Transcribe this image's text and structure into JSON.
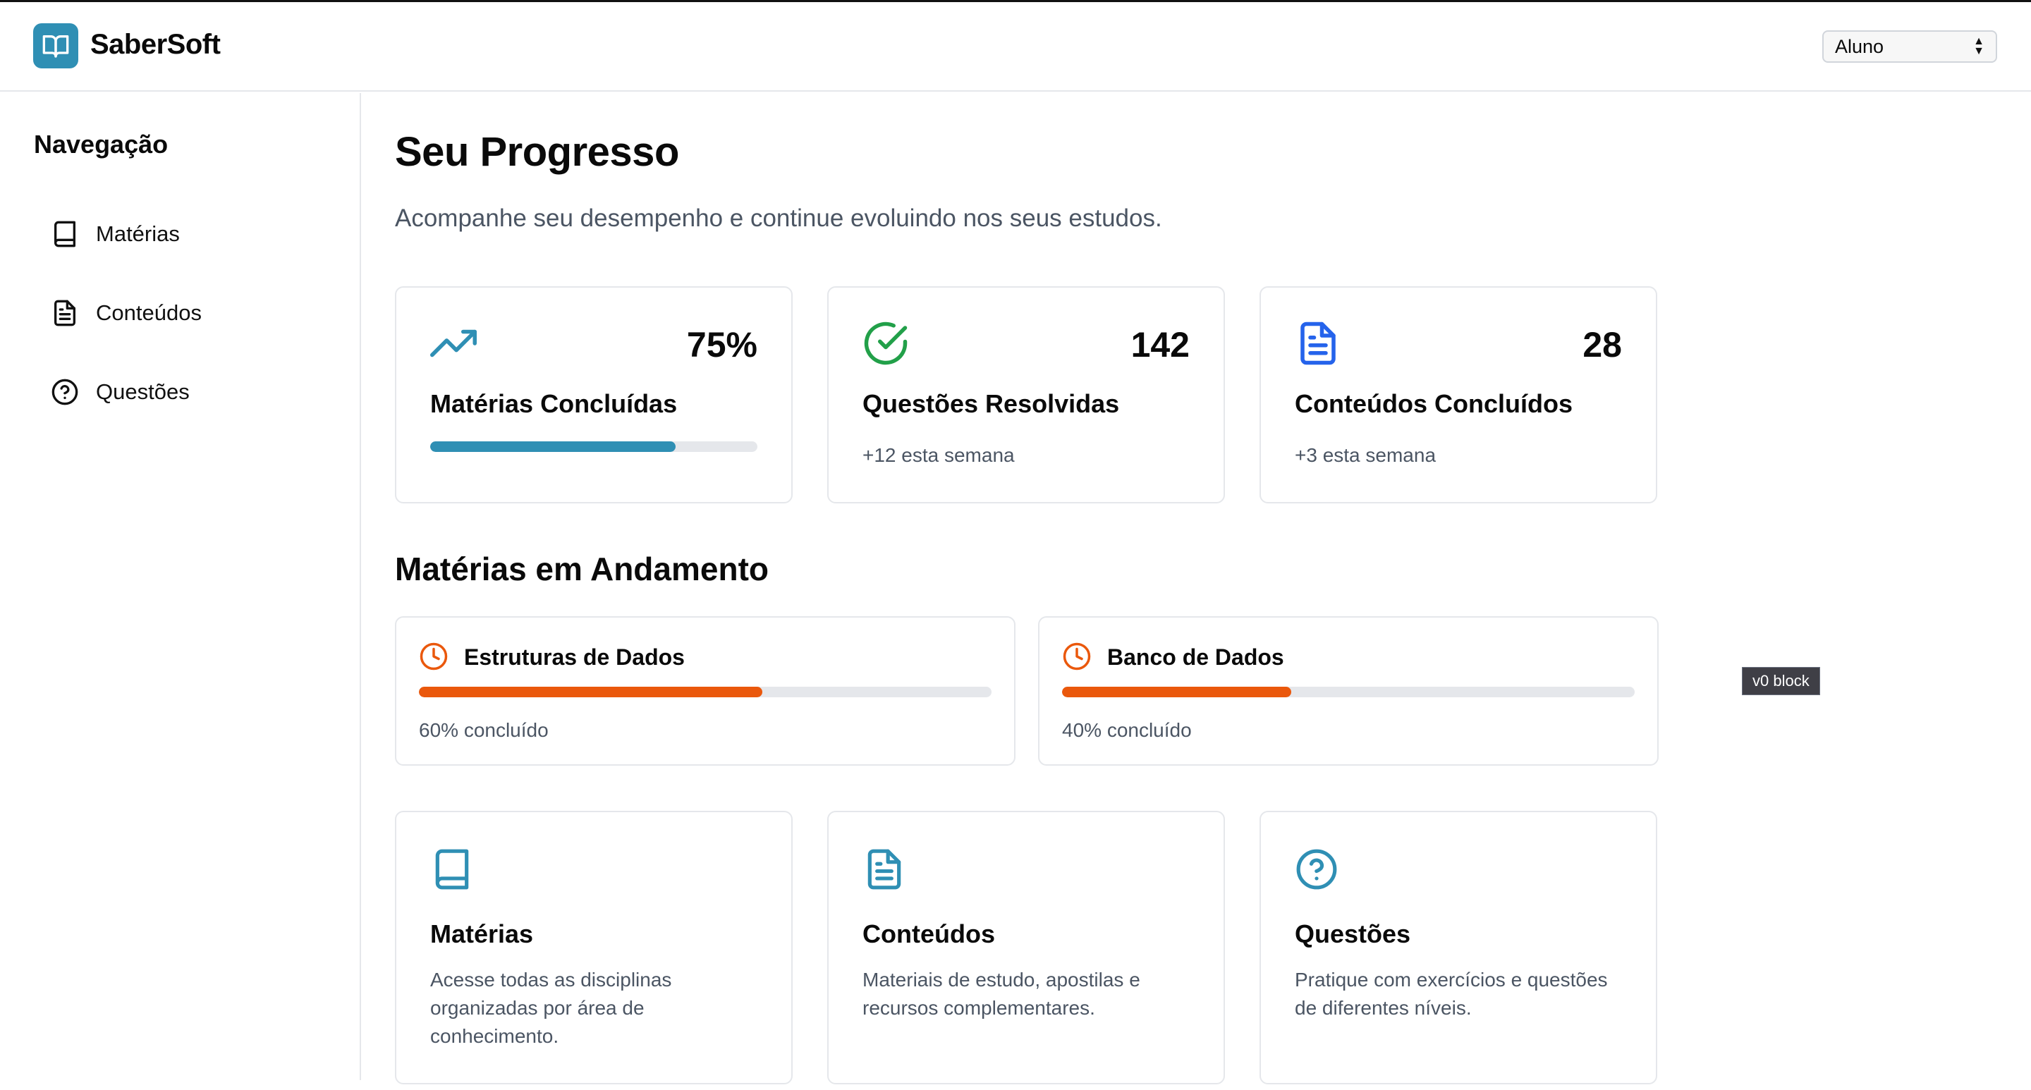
{
  "header": {
    "brand": "SaberSoft",
    "role_select": {
      "value": "Aluno"
    }
  },
  "sidebar": {
    "title": "Navegação",
    "items": [
      {
        "label": "Matérias",
        "icon": "book-icon"
      },
      {
        "label": "Conteúdos",
        "icon": "document-icon"
      },
      {
        "label": "Questões",
        "icon": "help-circle-icon"
      }
    ]
  },
  "main": {
    "title": "Seu Progresso",
    "subtitle": "Acompanhe seu desempenho e continue evoluindo nos seus estudos.",
    "stats": [
      {
        "value": "75%",
        "label": "Matérias Concluídas",
        "icon": "trending-up-icon",
        "progress": 0.75,
        "color": "#2f8fb4"
      },
      {
        "value": "142",
        "label": "Questões Resolvidas",
        "note": "+12 esta semana",
        "icon": "check-circle-icon",
        "color": "#22a049"
      },
      {
        "value": "28",
        "label": "Conteúdos Concluídos",
        "note": "+3 esta semana",
        "icon": "document-icon",
        "color": "#2563eb"
      }
    ],
    "in_progress_title": "Matérias em Andamento",
    "courses": [
      {
        "name": "Estruturas de Dados",
        "progress": 0.6,
        "progress_text": "60% concluído",
        "icon": "clock-icon",
        "color": "#ea580c"
      },
      {
        "name": "Banco de Dados",
        "progress": 0.4,
        "progress_text": "40% concluído",
        "icon": "clock-icon",
        "color": "#ea580c"
      }
    ],
    "links": [
      {
        "title": "Matérias",
        "description": "Acesse todas as disciplinas organizadas por área de conhecimento.",
        "icon": "book-icon",
        "color": "#2f8fb4"
      },
      {
        "title": "Conteúdos",
        "description": "Materiais de estudo, apostilas e recursos complementares.",
        "icon": "document-icon",
        "color": "#2f8fb4"
      },
      {
        "title": "Questões",
        "description": "Pratique com exercícios e questões de diferentes níveis.",
        "icon": "help-circle-icon",
        "color": "#2f8fb4"
      }
    ]
  },
  "tooltip": {
    "text": "v0 block"
  }
}
